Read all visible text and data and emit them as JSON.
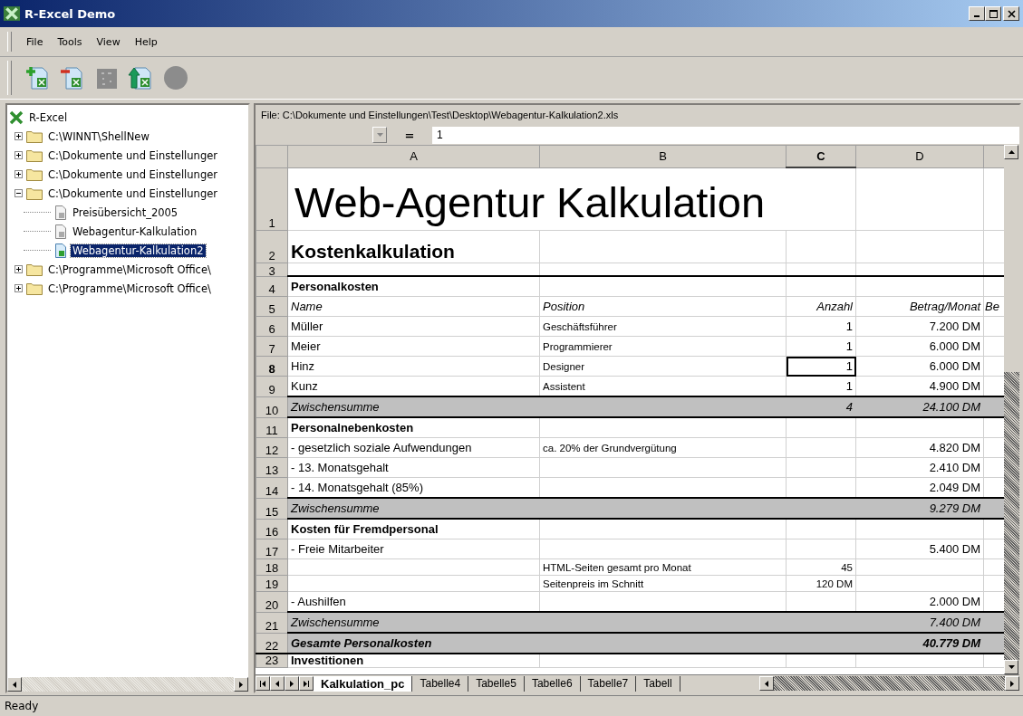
{
  "window": {
    "title": "R-Excel Demo"
  },
  "menu": [
    {
      "label": "File"
    },
    {
      "label": "Tools"
    },
    {
      "label": "View"
    },
    {
      "label": "Help"
    }
  ],
  "toolbar": [
    {
      "kind": "add",
      "disabled": false
    },
    {
      "kind": "remove",
      "disabled": false
    },
    {
      "kind": "macro",
      "disabled": true
    },
    {
      "kind": "reload",
      "disabled": false
    },
    {
      "kind": "record",
      "disabled": true
    }
  ],
  "tree": {
    "label": "R-Excel",
    "children": [
      {
        "label": "C:\\WINNT\\ShellNew",
        "kind": "folder",
        "expanded": false,
        "selected": false
      },
      {
        "label": "C:\\Dokumente und Einstellunger",
        "kind": "folder",
        "expanded": false,
        "selected": false
      },
      {
        "label": "C:\\Dokumente und Einstellunger",
        "kind": "folder",
        "expanded": false,
        "selected": false
      },
      {
        "label": "C:\\Dokumente und Einstellunger",
        "kind": "folder",
        "expanded": true,
        "selected": false,
        "children": [
          {
            "label": "Preisübersicht_2005",
            "kind": "file",
            "loaded": false,
            "selected": false
          },
          {
            "label": "Webagentur-Kalkulation",
            "kind": "file",
            "loaded": false,
            "selected": false
          },
          {
            "label": "Webagentur-Kalkulation2",
            "kind": "file",
            "loaded": true,
            "selected": true
          }
        ]
      },
      {
        "label": "C:\\Programme\\Microsoft Office\\",
        "kind": "folder",
        "expanded": false,
        "selected": false
      },
      {
        "label": "C:\\Programme\\Microsoft Office\\",
        "kind": "folder",
        "expanded": false,
        "selected": false
      }
    ]
  },
  "file_path": "File: C:\\Dokumente und Einstellungen\\Test\\Desktop\\Webagentur-Kalkulation2.xls",
  "formula_bar": {
    "equals": "=",
    "value": "1"
  },
  "columns": [
    {
      "label": "A",
      "selected": false
    },
    {
      "label": "B",
      "selected": false
    },
    {
      "label": "C",
      "selected": true
    },
    {
      "label": "D",
      "selected": false
    }
  ],
  "rows": [
    {
      "number": "1",
      "kind": "title",
      "selected": false,
      "a": "Web-Agentur Kalkulation"
    },
    {
      "number": "2",
      "kind": "subtitle",
      "selected": false,
      "a": "Kostenkalkulation"
    },
    {
      "number": "3",
      "kind": "blank",
      "selected": false
    },
    {
      "number": "4",
      "kind": "section",
      "selected": false,
      "a": "Personalkosten"
    },
    {
      "number": "5",
      "kind": "header",
      "selected": false,
      "a": "Name",
      "b": "Position",
      "c": "Anzahl",
      "d": "Betrag/Monat",
      "e": "Be"
    },
    {
      "number": "6",
      "kind": "data",
      "selected": false,
      "a": "Müller",
      "b": "Geschäftsführer",
      "c": "1",
      "d": "7.200 DM"
    },
    {
      "number": "7",
      "kind": "data",
      "selected": false,
      "a": "Meier",
      "b": "Programmierer",
      "c": "1",
      "d": "6.000 DM"
    },
    {
      "number": "8",
      "kind": "data",
      "selected": true,
      "active_c": true,
      "a": "Hinz",
      "b": "Designer",
      "c": "1",
      "d": "6.000 DM"
    },
    {
      "number": "9",
      "kind": "data",
      "selected": false,
      "a": "Kunz",
      "b": "Assistent",
      "c": "1",
      "d": "4.900 DM"
    },
    {
      "number": "10",
      "kind": "subtotal",
      "selected": false,
      "a": "Zwischensumme",
      "c": "4",
      "d": "24.100 DM"
    },
    {
      "number": "11",
      "kind": "section",
      "selected": false,
      "a": "Personalnebenkosten"
    },
    {
      "number": "12",
      "kind": "data",
      "selected": false,
      "a": "- gesetzlich soziale Aufwendungen",
      "b": "ca. 20% der Grundvergütung",
      "d": "4.820 DM"
    },
    {
      "number": "13",
      "kind": "data",
      "selected": false,
      "a": "- 13. Monatsgehalt",
      "d": "2.410 DM"
    },
    {
      "number": "14",
      "kind": "data",
      "selected": false,
      "a": "- 14. Monatsgehalt (85%)",
      "d": "2.049 DM"
    },
    {
      "number": "15",
      "kind": "subtotal",
      "selected": false,
      "a": "Zwischensumme",
      "d": "9.279 DM"
    },
    {
      "number": "16",
      "kind": "section",
      "selected": false,
      "a": "Kosten für Fremdpersonal"
    },
    {
      "number": "17",
      "kind": "data",
      "selected": false,
      "a": " - Freie Mitarbeiter",
      "d": "5.400 DM"
    },
    {
      "number": "18",
      "kind": "small",
      "selected": false,
      "b": "HTML-Seiten gesamt pro Monat",
      "c": "45"
    },
    {
      "number": "19",
      "kind": "small",
      "selected": false,
      "b": "Seitenpreis im Schnitt",
      "c": "120 DM"
    },
    {
      "number": "20",
      "kind": "data",
      "selected": false,
      "a": "- Aushilfen",
      "d": "2.000 DM"
    },
    {
      "number": "21",
      "kind": "subtotal",
      "selected": false,
      "a": "Zwischensumme",
      "d": "7.400 DM"
    },
    {
      "number": "22",
      "kind": "total",
      "selected": false,
      "a": "Gesamte Personalkosten",
      "d": "40.779 DM"
    },
    {
      "number": "23",
      "kind": "partial",
      "selected": false,
      "a": "Investitionen"
    }
  ],
  "sheet_tabs": [
    {
      "label": "Kalkulation_pc",
      "selected": true
    },
    {
      "label": "Tabelle4",
      "selected": false
    },
    {
      "label": "Tabelle5",
      "selected": false
    },
    {
      "label": "Tabelle6",
      "selected": false
    },
    {
      "label": "Tabelle7",
      "selected": false
    },
    {
      "label": "Tabell",
      "selected": false
    }
  ],
  "status_bar": "Ready"
}
